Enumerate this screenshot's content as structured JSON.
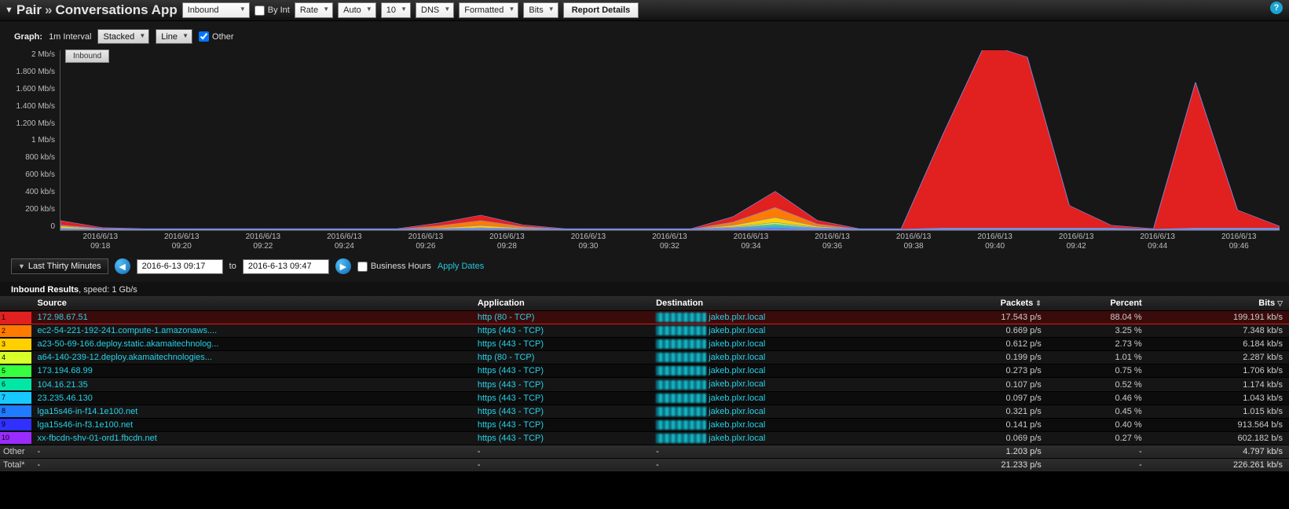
{
  "topbar": {
    "title_left": "Pair",
    "title_sep": "»",
    "title_right": "Conversations App",
    "selects": {
      "direction": "Inbound",
      "byint_label": "By Int",
      "rate": "Rate",
      "auto": "Auto",
      "count": "10",
      "resolve": "DNS",
      "format": "Formatted",
      "unit": "Bits"
    },
    "report_btn": "Report Details"
  },
  "graphbar": {
    "graph_label": "Graph:",
    "interval": "1m Interval",
    "stack": "Stacked",
    "line": "Line",
    "other_label": "Other"
  },
  "chart_data": {
    "type": "area",
    "title": "",
    "xlabel": "",
    "ylabel": "",
    "ylim_label_max": "2 Mb/s",
    "ylim": [
      0,
      2000
    ],
    "y_ticks": [
      "2 Mb/s",
      "1.800 Mb/s",
      "1.600 Mb/s",
      "1.400 Mb/s",
      "1.200 Mb/s",
      "1 Mb/s",
      "800 kb/s",
      "600 kb/s",
      "400 kb/s",
      "200 kb/s",
      "0"
    ],
    "x_ticks": [
      {
        "d": "2016/6/13",
        "t": "09:18"
      },
      {
        "d": "2016/6/13",
        "t": "09:20"
      },
      {
        "d": "2016/6/13",
        "t": "09:22"
      },
      {
        "d": "2016/6/13",
        "t": "09:24"
      },
      {
        "d": "2016/6/13",
        "t": "09:26"
      },
      {
        "d": "2016/6/13",
        "t": "09:28"
      },
      {
        "d": "2016/6/13",
        "t": "09:30"
      },
      {
        "d": "2016/6/13",
        "t": "09:32"
      },
      {
        "d": "2016/6/13",
        "t": "09:34"
      },
      {
        "d": "2016/6/13",
        "t": "09:36"
      },
      {
        "d": "2016/6/13",
        "t": "09:38"
      },
      {
        "d": "2016/6/13",
        "t": "09:40"
      },
      {
        "d": "2016/6/13",
        "t": "09:42"
      },
      {
        "d": "2016/6/13",
        "t": "09:44"
      },
      {
        "d": "2016/6/13",
        "t": "09:46"
      }
    ],
    "x_minutes": [
      18,
      19,
      20,
      21,
      22,
      23,
      24,
      25,
      26,
      27,
      28,
      29,
      30,
      31,
      32,
      33,
      34,
      35,
      36,
      37,
      38,
      39,
      40,
      41,
      42,
      43,
      44,
      45,
      46,
      47
    ],
    "series": [
      {
        "name": "172.98.67.51",
        "color": "#e12020",
        "values": [
          50,
          10,
          5,
          5,
          5,
          5,
          5,
          5,
          5,
          30,
          60,
          20,
          5,
          5,
          5,
          5,
          60,
          180,
          40,
          5,
          5,
          1050,
          2050,
          1900,
          250,
          30,
          5,
          1620,
          200,
          20
        ]
      },
      {
        "name": "ec2-54-221-192-241",
        "color": "#ff7a00",
        "values": [
          10,
          5,
          2,
          2,
          2,
          2,
          2,
          2,
          2,
          25,
          55,
          15,
          2,
          2,
          2,
          2,
          35,
          110,
          25,
          2,
          2,
          5,
          5,
          5,
          5,
          5,
          2,
          5,
          5,
          5
        ]
      },
      {
        "name": "a23-50-69-166",
        "color": "#ffcf00",
        "values": [
          25,
          5,
          2,
          2,
          2,
          2,
          2,
          2,
          2,
          10,
          25,
          10,
          2,
          2,
          2,
          2,
          20,
          55,
          15,
          2,
          2,
          5,
          5,
          5,
          5,
          5,
          2,
          5,
          5,
          5
        ]
      },
      {
        "name": "a64-140-239-12",
        "color": "#d7ff2a",
        "values": [
          5,
          2,
          1,
          1,
          1,
          1,
          1,
          1,
          1,
          4,
          8,
          4,
          1,
          1,
          1,
          1,
          8,
          20,
          6,
          1,
          1,
          2,
          2,
          2,
          2,
          2,
          1,
          2,
          2,
          2
        ]
      },
      {
        "name": "173.194.68.99",
        "color": "#35ff3f",
        "values": [
          3,
          1,
          1,
          1,
          1,
          1,
          1,
          1,
          1,
          2,
          5,
          2,
          1,
          1,
          1,
          1,
          6,
          15,
          5,
          1,
          1,
          2,
          2,
          2,
          2,
          2,
          1,
          2,
          2,
          2
        ]
      },
      {
        "name": "104.16.21.35",
        "color": "#00e7a6",
        "values": [
          3,
          1,
          1,
          1,
          1,
          1,
          1,
          1,
          1,
          2,
          4,
          2,
          1,
          1,
          1,
          1,
          5,
          12,
          4,
          1,
          1,
          2,
          2,
          2,
          2,
          2,
          1,
          2,
          2,
          2
        ]
      },
      {
        "name": "23.235.46.130",
        "color": "#18c9ff",
        "values": [
          3,
          1,
          1,
          1,
          1,
          1,
          1,
          1,
          1,
          2,
          3,
          2,
          1,
          1,
          1,
          1,
          5,
          12,
          4,
          1,
          1,
          2,
          2,
          2,
          2,
          2,
          1,
          2,
          2,
          2
        ]
      },
      {
        "name": "lga15s46-in-f14",
        "color": "#1f7bff",
        "values": [
          3,
          1,
          1,
          1,
          1,
          1,
          1,
          1,
          1,
          2,
          3,
          2,
          1,
          1,
          1,
          1,
          5,
          12,
          4,
          1,
          1,
          2,
          2,
          2,
          2,
          2,
          1,
          2,
          2,
          2
        ]
      },
      {
        "name": "lga15s46-in-f3",
        "color": "#3030ff",
        "values": [
          2,
          1,
          1,
          1,
          1,
          1,
          1,
          1,
          1,
          1,
          2,
          1,
          1,
          1,
          1,
          1,
          3,
          8,
          3,
          1,
          1,
          2,
          2,
          2,
          2,
          2,
          1,
          2,
          2,
          2
        ]
      },
      {
        "name": "xx-fbcdn-shv-01-ord1",
        "color": "#9a2cff",
        "values": [
          2,
          1,
          1,
          1,
          1,
          1,
          1,
          1,
          1,
          1,
          2,
          1,
          1,
          1,
          1,
          1,
          3,
          7,
          3,
          1,
          1,
          2,
          2,
          2,
          2,
          2,
          1,
          2,
          2,
          2
        ]
      }
    ],
    "legend_tab": "Inbound"
  },
  "timectrl": {
    "range_pill": "Last Thirty Minutes",
    "from": "2016-6-13 09:17",
    "to_label": "to",
    "to": "2016-6-13 09:47",
    "business_label": "Business Hours",
    "apply": "Apply Dates"
  },
  "results": {
    "label_prefix": "Inbound Results",
    "label_suffix": ", speed: 1 Gb/s",
    "columns": {
      "source": "Source",
      "application": "Application",
      "destination": "Destination",
      "packets": "Packets",
      "percent": "Percent",
      "bits": "Bits"
    },
    "rows": [
      {
        "n": "1",
        "color": "#e12020",
        "source": "172.98.67.51",
        "app": "http (80 - TCP)",
        "dest": "jakeb.plxr.local",
        "packets": "17.543 p/s",
        "percent": "88.04 %",
        "bits": "199.191 kb/s",
        "hl": true
      },
      {
        "n": "2",
        "color": "#ff7a00",
        "source": "ec2-54-221-192-241.compute-1.amazonaws....",
        "app": "https (443 - TCP)",
        "dest": "jakeb.plxr.local",
        "packets": "0.669 p/s",
        "percent": "3.25 %",
        "bits": "7.348 kb/s"
      },
      {
        "n": "3",
        "color": "#ffcf00",
        "source": "a23-50-69-166.deploy.static.akamaitechnolog...",
        "app": "https (443 - TCP)",
        "dest": "jakeb.plxr.local",
        "packets": "0.612 p/s",
        "percent": "2.73 %",
        "bits": "6.184 kb/s"
      },
      {
        "n": "4",
        "color": "#d7ff2a",
        "source": "a64-140-239-12.deploy.akamaitechnologies...",
        "app": "http (80 - TCP)",
        "dest": "jakeb.plxr.local",
        "packets": "0.199 p/s",
        "percent": "1.01 %",
        "bits": "2.287 kb/s"
      },
      {
        "n": "5",
        "color": "#35ff3f",
        "source": "173.194.68.99",
        "app": "https (443 - TCP)",
        "dest": "jakeb.plxr.local",
        "packets": "0.273 p/s",
        "percent": "0.75 %",
        "bits": "1.706 kb/s"
      },
      {
        "n": "6",
        "color": "#00e7a6",
        "source": "104.16.21.35",
        "app": "https (443 - TCP)",
        "dest": "jakeb.plxr.local",
        "packets": "0.107 p/s",
        "percent": "0.52 %",
        "bits": "1.174 kb/s"
      },
      {
        "n": "7",
        "color": "#18c9ff",
        "source": "23.235.46.130",
        "app": "https (443 - TCP)",
        "dest": "jakeb.plxr.local",
        "packets": "0.097 p/s",
        "percent": "0.46 %",
        "bits": "1.043 kb/s"
      },
      {
        "n": "8",
        "color": "#1f7bff",
        "source": "lga15s46-in-f14.1e100.net",
        "app": "https (443 - TCP)",
        "dest": "jakeb.plxr.local",
        "packets": "0.321 p/s",
        "percent": "0.45 %",
        "bits": "1.015 kb/s"
      },
      {
        "n": "9",
        "color": "#3030ff",
        "source": "lga15s46-in-f3.1e100.net",
        "app": "https (443 - TCP)",
        "dest": "jakeb.plxr.local",
        "packets": "0.141 p/s",
        "percent": "0.40 %",
        "bits": "913.564 b/s"
      },
      {
        "n": "10",
        "color": "#9a2cff",
        "source": "xx-fbcdn-shv-01-ord1.fbcdn.net",
        "app": "https (443 - TCP)",
        "dest": "jakeb.plxr.local",
        "packets": "0.069 p/s",
        "percent": "0.27 %",
        "bits": "602.182 b/s"
      }
    ],
    "other": {
      "label": "Other",
      "dash": "-",
      "packets": "1.203 p/s",
      "percent": "-",
      "bits": "4.797 kb/s"
    },
    "total": {
      "label": "Total*",
      "dash": "-",
      "packets": "21.233 p/s",
      "percent": "-",
      "bits": "226.261 kb/s"
    }
  }
}
